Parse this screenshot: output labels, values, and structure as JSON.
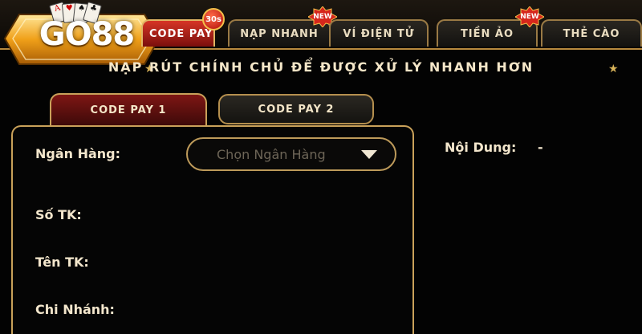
{
  "logo": {
    "text": "GO88",
    "icon": "playing-cards-icon",
    "cards": [
      "A",
      "♥",
      "♠",
      "♣"
    ]
  },
  "tabs": [
    {
      "label": "CODE PAY",
      "active": true,
      "badge": "30s"
    },
    {
      "label": "NẠP NHANH",
      "badge": "NEW"
    },
    {
      "label": "VÍ ĐIỆN TỬ"
    },
    {
      "label": "TIỀN ẢO",
      "badge": "NEW"
    },
    {
      "label": "THẺ CÀO"
    }
  ],
  "notice": {
    "text": "NẠP RÚT CHÍNH CHỦ ĐỂ ĐƯỢC XỬ LÝ NHANH HƠN",
    "icon": "star-icon"
  },
  "subtabs": [
    {
      "label": "CODE PAY 1",
      "active": true
    },
    {
      "label": "CODE PAY 2",
      "active": false
    }
  ],
  "form": {
    "bank_label": "Ngân Hàng:",
    "bank_placeholder": "Chọn Ngân Hàng",
    "account_number_label": "Số TK:",
    "account_name_label": "Tên TK:",
    "branch_label": "Chi Nhánh:"
  },
  "details": {
    "content_label": "Nội Dung:",
    "content_value": "-"
  },
  "colors": {
    "gold": "#c9a15a",
    "active_red": "#d63526",
    "background": "#030303"
  }
}
